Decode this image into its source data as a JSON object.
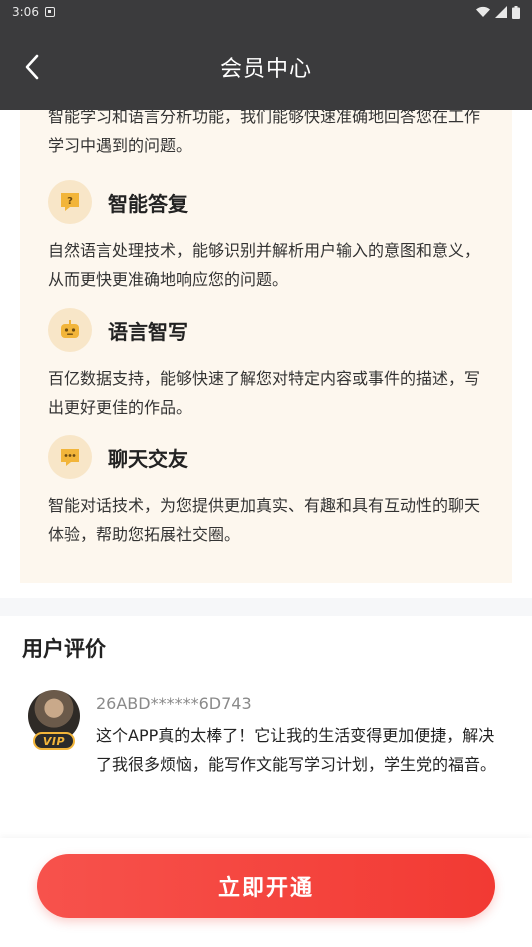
{
  "status_bar": {
    "time": "3:06"
  },
  "app_bar": {
    "title": "会员中心"
  },
  "features": {
    "intro": "智能学习和语言分析功能，我们能够快速准确地回答您在工作学习中遇到的问题。",
    "items": [
      {
        "icon": "question-bubble-icon",
        "title": "智能答复",
        "desc": "自然语言处理技术，能够识别并解析用户输入的意图和意义，从而更快更准确地响应您的问题。"
      },
      {
        "icon": "robot-icon",
        "title": "语言智写",
        "desc": "百亿数据支持，能够快速了解您对特定内容或事件的描述，写出更好更佳的作品。"
      },
      {
        "icon": "chat-bubble-icon",
        "title": "聊天交友",
        "desc": "智能对话技术，为您提供更加真实、有趣和具有互动性的聊天体验，帮助您拓展社交圈。"
      }
    ]
  },
  "reviews": {
    "title": "用户评价",
    "items": [
      {
        "user": "26ABD******6D743",
        "badge": "VIP",
        "text": "这个APP真的太棒了！它让我的生活变得更加便捷，解决了我很多烦恼，能写作文能写学习计划，学生党的福音。"
      }
    ]
  },
  "cta": {
    "label": "立即开通"
  },
  "colors": {
    "header": "#3b3b3d",
    "card": "#fdf7ee",
    "accent": "#f23a33",
    "icon_bg": "#f8e6c8",
    "icon": "#f2b53a"
  }
}
